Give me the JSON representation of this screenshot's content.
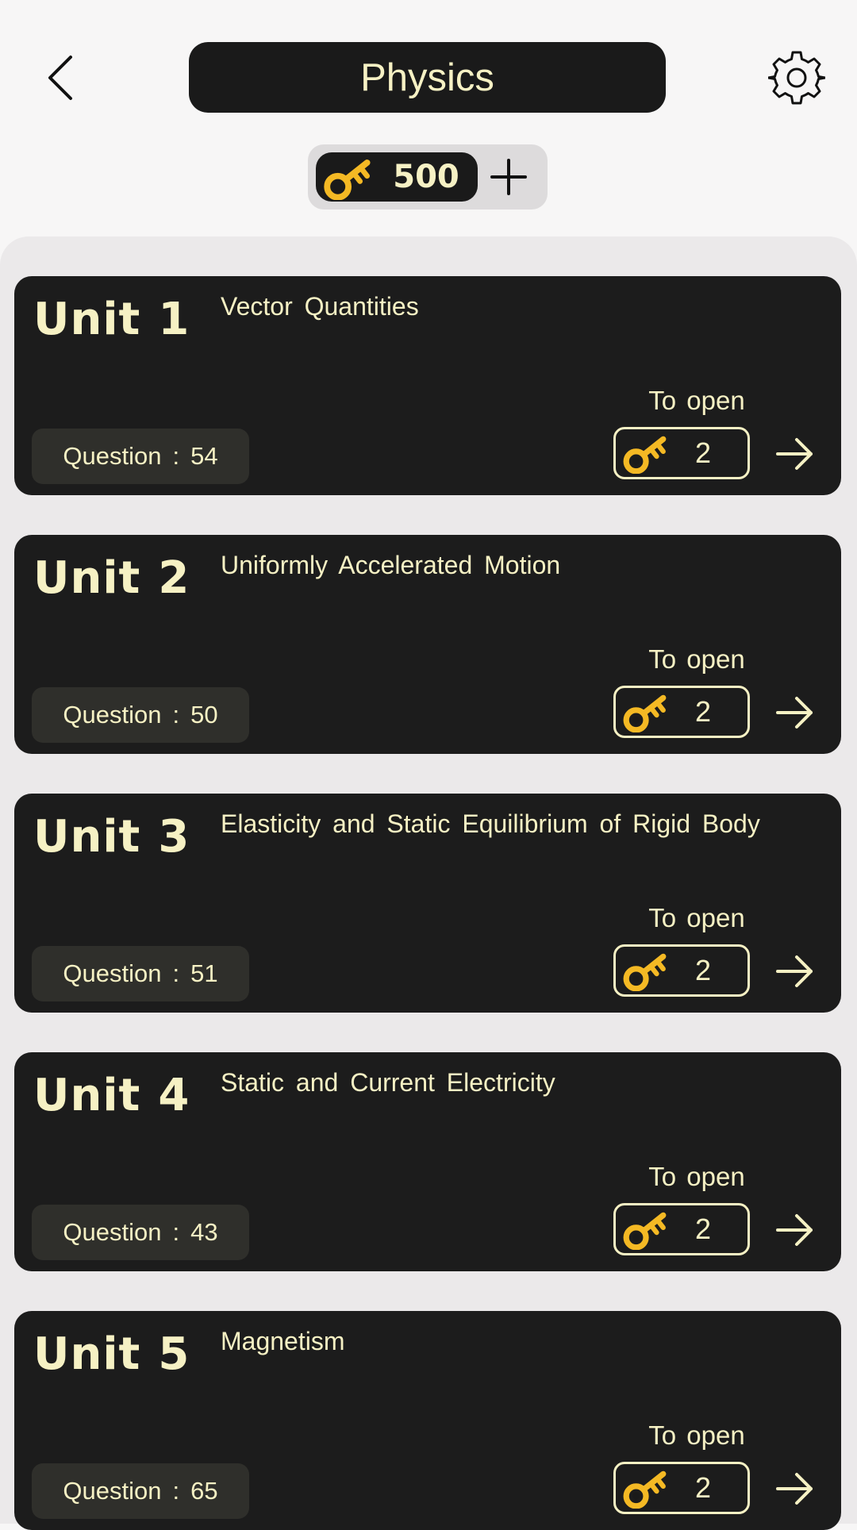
{
  "header": {
    "title": "Physics",
    "back_icon": "chevron-left-icon",
    "settings_icon": "gear-icon"
  },
  "keys": {
    "icon": "key-icon",
    "count": "500",
    "add_icon": "plus-icon"
  },
  "colors": {
    "accent_text": "#f6f1c4",
    "card_bg": "#1c1c1c",
    "key_gold": "#f4b924",
    "page_bg": "#f7f6f6"
  },
  "units": [
    {
      "label": "Unit",
      "number": "1",
      "title": "Vector Quantities",
      "question_label": "Question",
      "question_sep": ":",
      "question_count": "54",
      "to_open_label": "To open",
      "key_cost": "2"
    },
    {
      "label": "Unit",
      "number": "2",
      "title": "Uniformly Accelerated Motion",
      "question_label": "Question",
      "question_sep": ":",
      "question_count": "50",
      "to_open_label": "To open",
      "key_cost": "2"
    },
    {
      "label": "Unit",
      "number": "3",
      "title": "Elasticity and Static Equilibrium of Rigid Body",
      "question_label": "Question",
      "question_sep": ":",
      "question_count": "51",
      "to_open_label": "To open",
      "key_cost": "2"
    },
    {
      "label": "Unit",
      "number": "4",
      "title": "Static and Current Electricity",
      "question_label": "Question",
      "question_sep": ":",
      "question_count": "43",
      "to_open_label": "To open",
      "key_cost": "2"
    },
    {
      "label": "Unit",
      "number": "5",
      "title": "Magnetism",
      "question_label": "Question",
      "question_sep": ":",
      "question_count": "65",
      "to_open_label": "To open",
      "key_cost": "2"
    }
  ]
}
